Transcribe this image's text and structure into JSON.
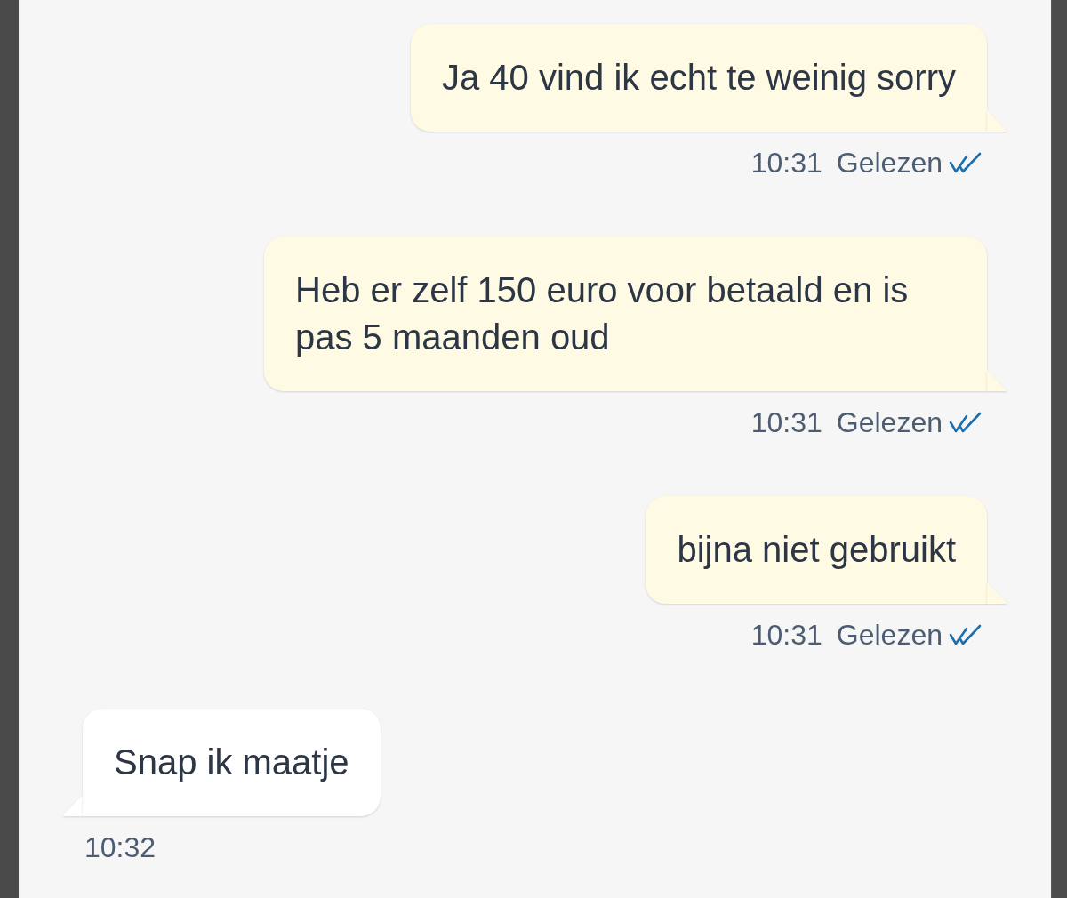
{
  "messages": [
    {
      "kind": "outgoing",
      "text": "Ja 40 vind ik echt te weinig sorry",
      "time": "10:31",
      "status": "Gelezen",
      "read": true
    },
    {
      "kind": "outgoing",
      "text": "Heb er zelf 150 euro voor betaald en is pas 5 maanden oud",
      "time": "10:31",
      "status": "Gelezen",
      "read": true
    },
    {
      "kind": "outgoing",
      "text": "bijna niet gebruikt",
      "time": "10:31",
      "status": "Gelezen",
      "read": true
    },
    {
      "kind": "incoming",
      "text": "Snap ik maatje",
      "time": "10:32"
    }
  ]
}
